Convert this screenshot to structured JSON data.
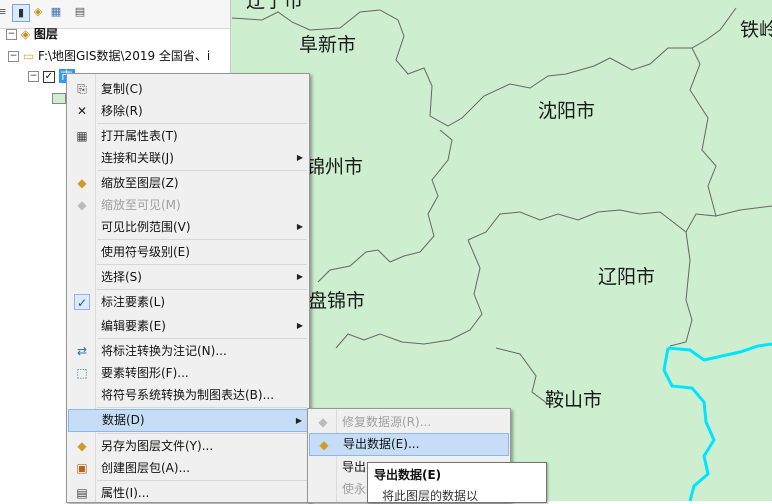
{
  "map": {
    "labels": {
      "liaoyang_top": "辽宁市",
      "fuxin": "阜新市",
      "tieling": "铁岭",
      "shenyang": "沈阳市",
      "jinzhou": "锦州市",
      "liaoyang": "辽阳市",
      "panjin": "盘锦市",
      "anshan": "鞍山市"
    },
    "fill_color": "#cdeecf",
    "border_color": "#666666",
    "highlight_border_color": "#00e5ff"
  },
  "toc": {
    "toolbar_icons": [
      "list-by-drawing-order-icon",
      "list-by-source-icon",
      "list-by-visibility-icon",
      "list-by-selection-icon",
      "options-icon"
    ],
    "layers_label": "图层",
    "folder_path": "F:\\地图GIS数据\\2019 全国省、i",
    "layer_name": "市"
  },
  "context_menu": {
    "items": [
      {
        "label": "复制(C)",
        "icon": "copy-icon"
      },
      {
        "label": "移除(R)",
        "icon": "remove-icon"
      },
      {
        "label": "打开属性表(T)",
        "icon": "attribute-table-icon"
      },
      {
        "label": "连接和关联(J)",
        "icon": "",
        "submenu": true
      },
      {
        "label": "缩放至图层(Z)",
        "icon": "zoom-to-layer-icon"
      },
      {
        "label": "缩放至可见(M)",
        "icon": "zoom-to-visible-icon",
        "disabled": true
      },
      {
        "label": "可见比例范围(V)",
        "icon": "",
        "submenu": true
      },
      {
        "label": "使用符号级别(E)",
        "icon": ""
      },
      {
        "label": "选择(S)",
        "icon": "",
        "submenu": true
      },
      {
        "label": "标注要素(L)",
        "icon": "check-icon"
      },
      {
        "label": "编辑要素(E)",
        "icon": "",
        "submenu": true
      },
      {
        "label": "将标注转换为注记(N)...",
        "icon": "convert-labels-icon"
      },
      {
        "label": "要素转图形(F)...",
        "icon": "features-to-graphics-icon"
      },
      {
        "label": "将符号系统转换为制图表达(B)...",
        "icon": ""
      },
      {
        "label": "数据(D)",
        "icon": "",
        "submenu": true,
        "highlighted": true
      },
      {
        "label": "另存为图层文件(Y)...",
        "icon": "save-layer-file-icon"
      },
      {
        "label": "创建图层包(A)...",
        "icon": "create-layer-package-icon"
      },
      {
        "label": "属性(I)...",
        "icon": "properties-icon"
      }
    ]
  },
  "data_submenu": {
    "items": [
      {
        "label": "修复数据源(R)...",
        "icon": "repair-data-source-icon",
        "disabled": true
      },
      {
        "label": "导出数据(E)...",
        "icon": "export-data-icon",
        "highlighted": true
      },
      {
        "label": "导出",
        "icon": ""
      },
      {
        "label": "使永",
        "icon": "",
        "disabled": true
      }
    ]
  },
  "tooltip": {
    "title": "导出数据(E)",
    "body": "将此图层的数据以"
  }
}
